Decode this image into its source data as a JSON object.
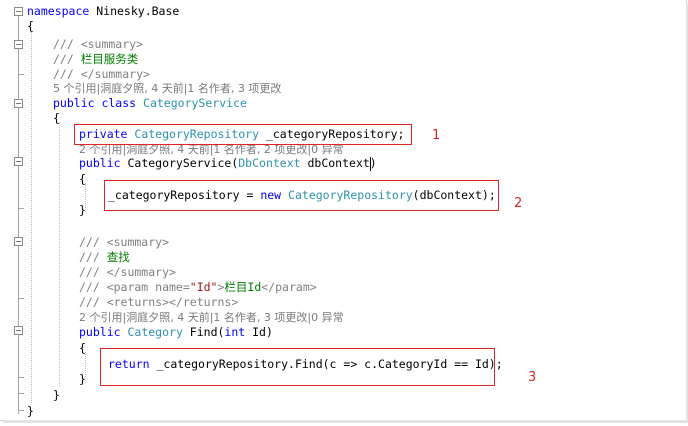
{
  "code": {
    "namespace_kw": "namespace",
    "namespace_name": " Ninesky.Base",
    "brace_open": "{",
    "brace_close": "}",
    "class_summary_open": "/// <summary>",
    "class_summary_text_prefix": "/// ",
    "class_summary_text": "栏目服务类",
    "class_summary_close": "/// </summary>",
    "class_lens": "5 个引用|洞庭夕照, 4 天前|1 名作者, 3 项更改",
    "class_decl_kw": "public class",
    "class_name": "CategoryService",
    "field_kw": "private",
    "field_type": "CategoryRepository",
    "field_name": " _categoryRepository;",
    "ctor_lens": "2 个引用|洞庭夕照, 4 天前|1 名作者, 2 项更改|0 异常",
    "ctor_kw": "public",
    "ctor_name": " CategoryService(",
    "ctor_param_type": "DbContext",
    "ctor_param_name": " dbContext)",
    "ctor_body_var": "_categoryRepository = ",
    "ctor_body_new": "new",
    "ctor_body_type": "CategoryRepository",
    "ctor_body_args": "(dbContext);",
    "find_summary_open": "/// <summary>",
    "find_summary_text_prefix": "/// ",
    "find_summary_text": "查找",
    "find_summary_close": "/// </summary>",
    "find_param_prefix": "/// <param name=",
    "find_param_quote_name": "\"Id\"",
    "find_param_gt": ">",
    "find_param_text": "栏目Id",
    "find_param_close": "</param>",
    "find_returns": "/// <returns></returns>",
    "find_lens": "2 个引用|洞庭夕照, 4 天前|1 名作者, 3 项更改|0 异常",
    "find_kw": "public",
    "find_type": "Category",
    "find_name": " Find(",
    "find_param_kw": "int",
    "find_param_var": " Id)",
    "find_return_kw": "return",
    "find_return_expr": " _categoryRepository.Find(c => c.CategoryId == Id);"
  },
  "annotations": {
    "label_1": "1",
    "label_2": "2",
    "label_3": "3",
    "color": "#e02424"
  },
  "colors": {
    "keyword": "#0000ff",
    "type": "#2b91af",
    "comment": "#008000",
    "codelens": "#7a7a7a"
  }
}
